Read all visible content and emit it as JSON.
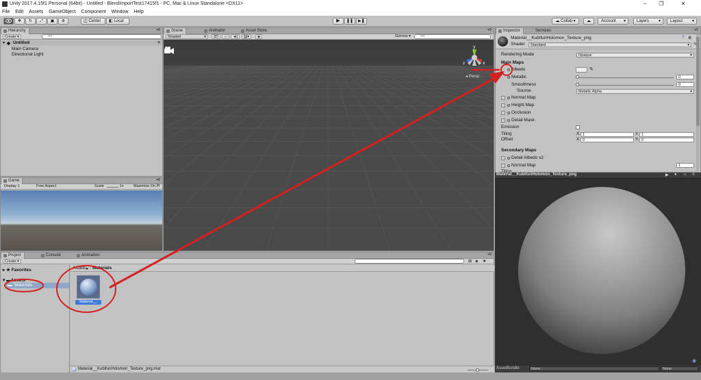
{
  "window": {
    "title": "Unity 2017.4.15f1 Personal (64bit) - Untitled - BlendImportTest17415f1 - PC, Mac & Linux Standalone <DX11>",
    "controls": [
      "–",
      "❐",
      "✕"
    ]
  },
  "menu": [
    "File",
    "Edit",
    "Assets",
    "GameObject",
    "Component",
    "Window",
    "Help"
  ],
  "toolbar": {
    "pivot": "Center",
    "space": "Local",
    "collab": "Collab ▾",
    "account": "Account",
    "layers": "Layers",
    "layout": "Layout"
  },
  "hierarchy": {
    "tab": "Hierarchy",
    "create": "Create ▾",
    "search_placeholder": "All",
    "scene_name": "Untitled",
    "items": [
      "Main Camera",
      "Directional Light"
    ]
  },
  "scene": {
    "tabs": [
      "Scene",
      "Animator",
      "Asset Store"
    ],
    "shading": "Shaded",
    "mode2d": "2D",
    "gizmos": "Gizmos ▾",
    "search_placeholder": "All",
    "persp": "Persp",
    "gizmo_axes": {
      "y": "y",
      "x": "x",
      "z": "z"
    }
  },
  "game": {
    "tab": "Game",
    "display": "Display 1",
    "aspect": "Free Aspect",
    "scale_label": "Scale",
    "scale_value": "1x",
    "maximize": "Maximize On Pl"
  },
  "project": {
    "tabs": [
      "Project",
      "Console",
      "Animation"
    ],
    "create": "Create ▾",
    "favorites": "Favorites",
    "assets": "Assets",
    "materials_folder": "Materials",
    "breadcrumb_root": "Assets",
    "breadcrumb_sep": "▸",
    "breadcrumb_current": "Materials",
    "asset_label": "Material__",
    "footer_path": "Material__KubifuriHolomon_Texture_png.mat"
  },
  "inspector": {
    "tabs": [
      "Inspector",
      "Services"
    ],
    "material_name": "Material__KubifuriHolomon_Texture_png",
    "shader_label": "Shader",
    "shader_value": "Standard",
    "rendering_mode_label": "Rendering Mode",
    "rendering_mode_value": "Opaque",
    "main_maps": "Main Maps",
    "albedo": "Albedo",
    "metallic": "Metallic",
    "metallic_value": "0",
    "smoothness": "Smoothness",
    "smoothness_value": "0",
    "source": "Source",
    "source_value": "Metallic Alpha",
    "normal_map": "Normal Map",
    "height_map": "Height Map",
    "occlusion": "Occlusion",
    "detail_mask": "Detail Mask",
    "emission": "Emission",
    "tiling": "Tiling",
    "offset": "Offset",
    "x": "X",
    "y": "Y",
    "tiling_x": "1",
    "tiling_y": "1",
    "offset_x": "0",
    "offset_y": "0",
    "secondary_maps": "Secondary Maps",
    "detail_albedo": "Detail Albedo x2",
    "normal_map2": "Normal Map",
    "normal_map2_value": "1",
    "tiling_partial": "Tiling"
  },
  "preview": {
    "title": "Material__KubifuriHolomon_Texture_png",
    "assetbundle_label": "AssetBundle",
    "assetbundle_value": "None",
    "variant_value": "None"
  },
  "annotation_color": "#d42020"
}
